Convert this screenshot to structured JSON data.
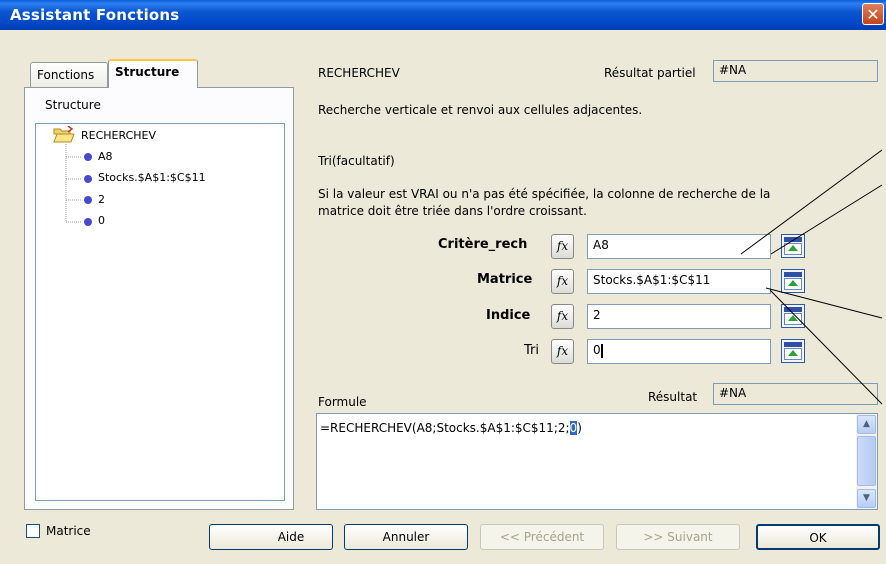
{
  "window": {
    "title": "Assistant Fonctions",
    "close_glyph": "✕"
  },
  "tabs": [
    {
      "label": "Fonctions",
      "active": false
    },
    {
      "label": "Structure",
      "active": true
    }
  ],
  "structure": {
    "label": "Structure",
    "root": "RECHERCHEV",
    "args": [
      "A8",
      "Stocks.$A$1:$C$11",
      "2",
      "0"
    ]
  },
  "function": {
    "name": "RECHERCHEV",
    "partial_result_label": "Résultat partiel",
    "partial_result_value": "#NA",
    "description": "Recherche verticale et renvoi aux cellules adjacentes.",
    "param_title": "Tri(facultatif)",
    "param_help_1": "Si la valeur est VRAI ou n'a pas été spécifiée, la colonne de recherche de la",
    "param_help_2": "matrice doit être triée dans l'ordre croissant."
  },
  "args": [
    {
      "label": "Critère_rech",
      "value": "A8",
      "bold": true
    },
    {
      "label": "Matrice",
      "value": "Stocks.$A$1:$C$11",
      "bold": true
    },
    {
      "label": "Indice",
      "value": "2",
      "bold": true
    },
    {
      "label": "Tri",
      "value": "0",
      "bold": false
    }
  ],
  "fx_label": "fx",
  "formula": {
    "label": "Formule",
    "result_label": "Résultat",
    "result_value": "#NA",
    "text_before": "=RECHERCHEV(A8;Stocks.$A$1:$C$11;2;",
    "text_selected": "0",
    "text_after": ")"
  },
  "footer": {
    "matrix_checkbox": "Matrice",
    "help": "Aide",
    "cancel": "Annuler",
    "previous": "<< Précédent",
    "next": ">> Suivant",
    "ok": "OK"
  },
  "colors": {
    "title_bar": "#0a55d0",
    "tree_bullet": "#4a49c9",
    "active_tab_top": "#ffc73c"
  }
}
